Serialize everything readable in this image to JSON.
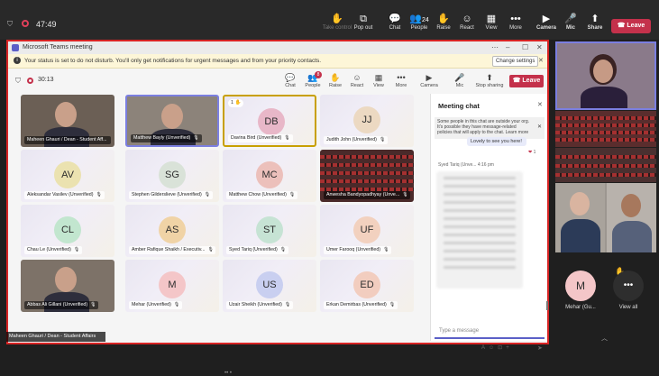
{
  "outer_bar": {
    "timer": "47:49",
    "buttons": [
      {
        "label": "Take control",
        "icon": "pointer-icon",
        "dim": true
      },
      {
        "label": "Pop out",
        "icon": "popout-icon",
        "dim": false
      },
      {
        "label": "Chat",
        "icon": "chat-icon",
        "dim": false
      },
      {
        "label": "People",
        "icon": "people-icon",
        "count": "24",
        "dim": false
      },
      {
        "label": "Raise",
        "icon": "hand-icon",
        "dim": false
      },
      {
        "label": "React",
        "icon": "smile-icon",
        "dim": false
      },
      {
        "label": "View",
        "icon": "grid-icon",
        "dim": false
      },
      {
        "label": "More",
        "icon": "more-icon",
        "dim": false
      },
      {
        "label": "Camera",
        "icon": "camera-icon",
        "dim": false
      },
      {
        "label": "Mic",
        "icon": "mic-icon",
        "dim": false
      },
      {
        "label": "Share",
        "icon": "share-icon",
        "dim": false
      }
    ],
    "leave": "Leave"
  },
  "window": {
    "title": "Microsoft Teams meeting",
    "notice": "Your status is set to do not disturb. You'll only get notifications for urgent messages and from your priority contacts.",
    "notice_button": "Change settings",
    "timer": "30:13",
    "toolbar": [
      {
        "label": "Chat",
        "icon": "chat-icon"
      },
      {
        "label": "People",
        "icon": "people-icon",
        "badge": "8"
      },
      {
        "label": "Raise",
        "icon": "hand-icon"
      },
      {
        "label": "React",
        "icon": "smile-icon"
      },
      {
        "label": "View",
        "icon": "grid-icon"
      },
      {
        "label": "More",
        "icon": "more-icon"
      },
      {
        "label": "Camera",
        "icon": "camera-icon"
      },
      {
        "label": "Mic",
        "icon": "mic-icon"
      },
      {
        "label": "Stop sharing",
        "icon": "share-icon"
      }
    ],
    "leave": "Leave"
  },
  "tiles": [
    {
      "name": "Maheen Ghauri / Dean - Student Aff...",
      "initials": "",
      "video": "video1"
    },
    {
      "name": "Matthew Bayly (Unverified)",
      "initials": "",
      "video": "video2"
    },
    {
      "name": "Davina Bird (Unverified)",
      "initials": "DB",
      "color": "#e8b7c8",
      "hand": "1"
    },
    {
      "name": "Judith John (Unverified)",
      "initials": "JJ",
      "color": "#ecd9c2"
    },
    {
      "name": "Aleksandar Vasilev (Unverified)",
      "initials": "AV",
      "color": "#ebe2b0"
    },
    {
      "name": "Stephen Gilderslieve (Unverified)",
      "initials": "SG",
      "color": "#d9e2d8"
    },
    {
      "name": "Matthew Chow (Unverified)",
      "initials": "MC",
      "color": "#ecc0bb"
    },
    {
      "name": "Anwesha Bandyopadhyay (Unve...",
      "initials": "",
      "video": "video3"
    },
    {
      "name": "Chau Le (Unverified)",
      "initials": "CL",
      "color": "#c2e6cf"
    },
    {
      "name": "Amber Rafique Shaikh / Executiv...",
      "initials": "AS",
      "color": "#f0d3a6"
    },
    {
      "name": "Syed Tariq (Unverified)",
      "initials": "ST",
      "color": "#c6e3d4"
    },
    {
      "name": "Umer Farooq (Unverified)",
      "initials": "UF",
      "color": "#f2d1bf"
    },
    {
      "name": "Abbas Ali Gillani (Unverified)",
      "initials": "",
      "video": "video4"
    },
    {
      "name": "Mehar (Unverified)",
      "initials": "M",
      "color": "#f4c6c8"
    },
    {
      "name": "Uzair Sheikh (Unverified)",
      "initials": "US",
      "color": "#c9cff0"
    },
    {
      "name": "Erkan Demirbas (Unverified)",
      "initials": "ED",
      "color": "#f2cdbf"
    }
  ],
  "chat": {
    "title": "Meeting chat",
    "info": "Some people in this chat are outside your org. It's possible they have message-related policies that will apply to the chat. Learn more",
    "message_preview": "Lovely to see you here!",
    "reaction_count": "1",
    "sender": "Syed Tariq (Unve...",
    "sender_time": "4:16 pm",
    "placeholder": "Type a message"
  },
  "presenter_label": "Maheen Ghauri / Dean - Student Affairs",
  "side": {
    "thumb4_name": "",
    "avatar": {
      "initials": "M",
      "name": "Mehar (Gu...",
      "color": "#f4c6c8"
    },
    "view_all": "View all"
  }
}
